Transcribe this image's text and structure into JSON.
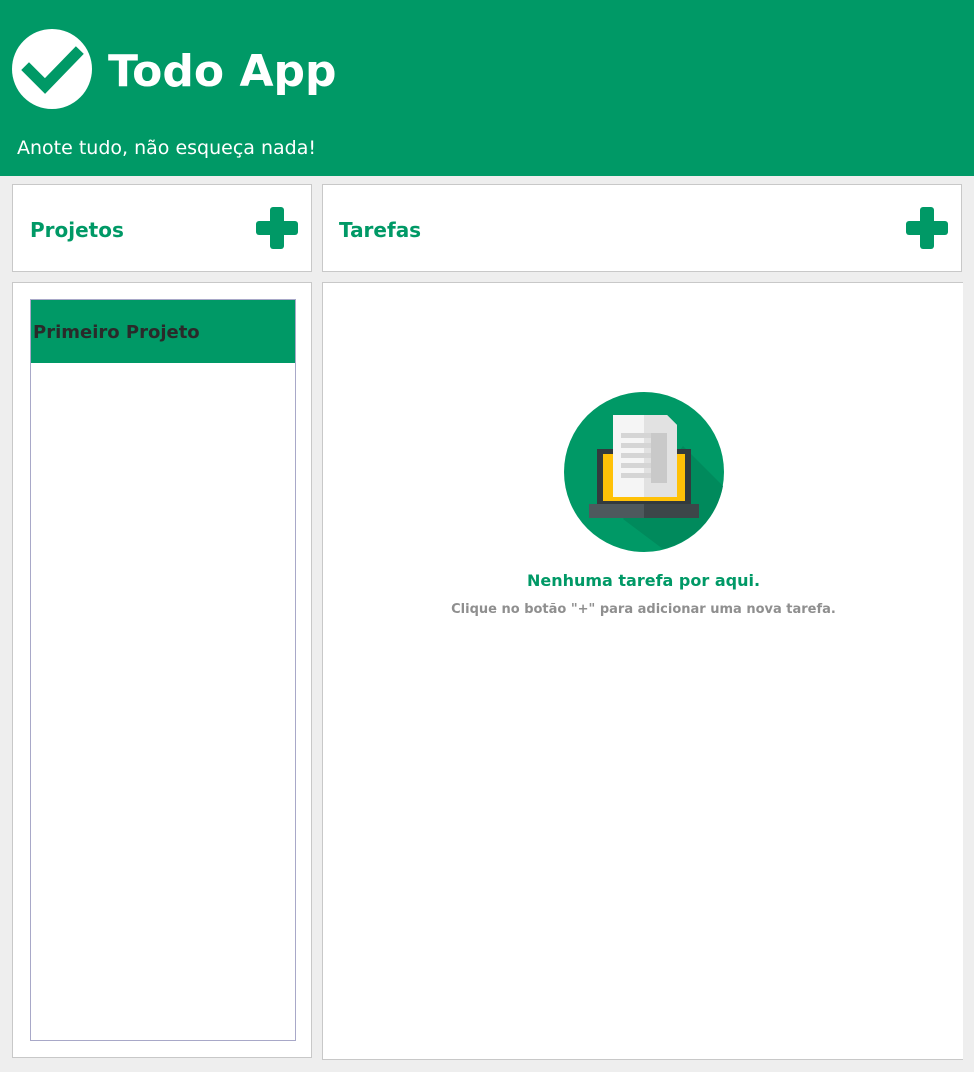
{
  "header": {
    "logo_icon": "checkmark-icon",
    "title": "Todo App",
    "subtitle": "Anote tudo, não esqueça nada!"
  },
  "projects": {
    "title": "Projetos",
    "add_icon": "plus-icon",
    "items": [
      {
        "label": "Primeiro Projeto",
        "selected": true
      }
    ]
  },
  "tasks": {
    "title": "Tarefas",
    "add_icon": "plus-icon",
    "empty_state": {
      "illustration_icon": "laptop-document-icon",
      "title": "Nenhuma tarefa por aqui.",
      "hint": "Clique no botão \"+\" para adicionar uma nova tarefa."
    }
  },
  "colors": {
    "brand": "#009966",
    "background": "#eeeeee",
    "accent_yellow": "#ffc107"
  }
}
